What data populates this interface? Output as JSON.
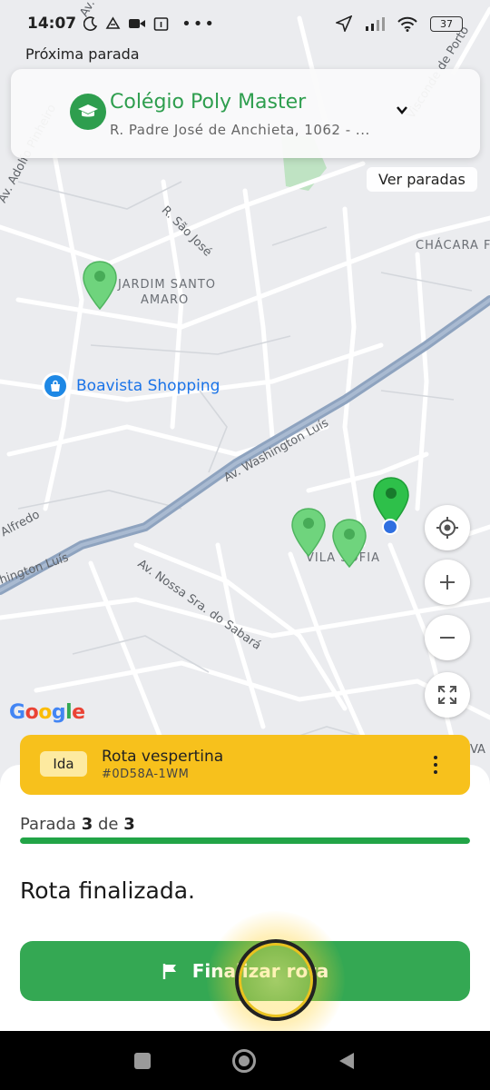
{
  "status_bar": {
    "time": "14:07",
    "battery": "37"
  },
  "next_stop": {
    "label": "Próxima parada",
    "name": "Colégio Poly Master",
    "address": "R. Padre José de Anchieta, 1062 - ..."
  },
  "see_stops_label": "Ver paradas",
  "map": {
    "places": {
      "neighborhood_1": "JARDIM SANTO",
      "neighborhood_1b": "AMARO",
      "neighborhood_2": "VILA SOFIA",
      "neighborhood_3": "CHÁCARA F",
      "shopping": "Boavista Shopping"
    },
    "streets": {
      "washington": "Av. Washington Luís",
      "washington_2": "hington Luís",
      "nossa_sra": "Av. Nossa Sra. do Sabará",
      "sao_jose": "R. São José",
      "adolfo": "Av. Adolfo Pinheiro",
      "alfredo": "Alfredo",
      "visconde": "Visconde de Porto",
      "av_frag": "Av.",
      "va_frag": "VA"
    },
    "google_label": "Google"
  },
  "route": {
    "direction_badge": "Ida",
    "name": "Rota vespertina",
    "code": "#0D58A-1WM"
  },
  "progress": {
    "prefix": "Parada",
    "current": "3",
    "connector": "de",
    "total": "3",
    "fraction": 1.0
  },
  "status_message": "Rota finalizada.",
  "finish_button_label": "Finalizar rota",
  "colors": {
    "accent_green": "#34a853",
    "route_yellow": "#f7c11c",
    "pin_green": "#3cc452"
  }
}
